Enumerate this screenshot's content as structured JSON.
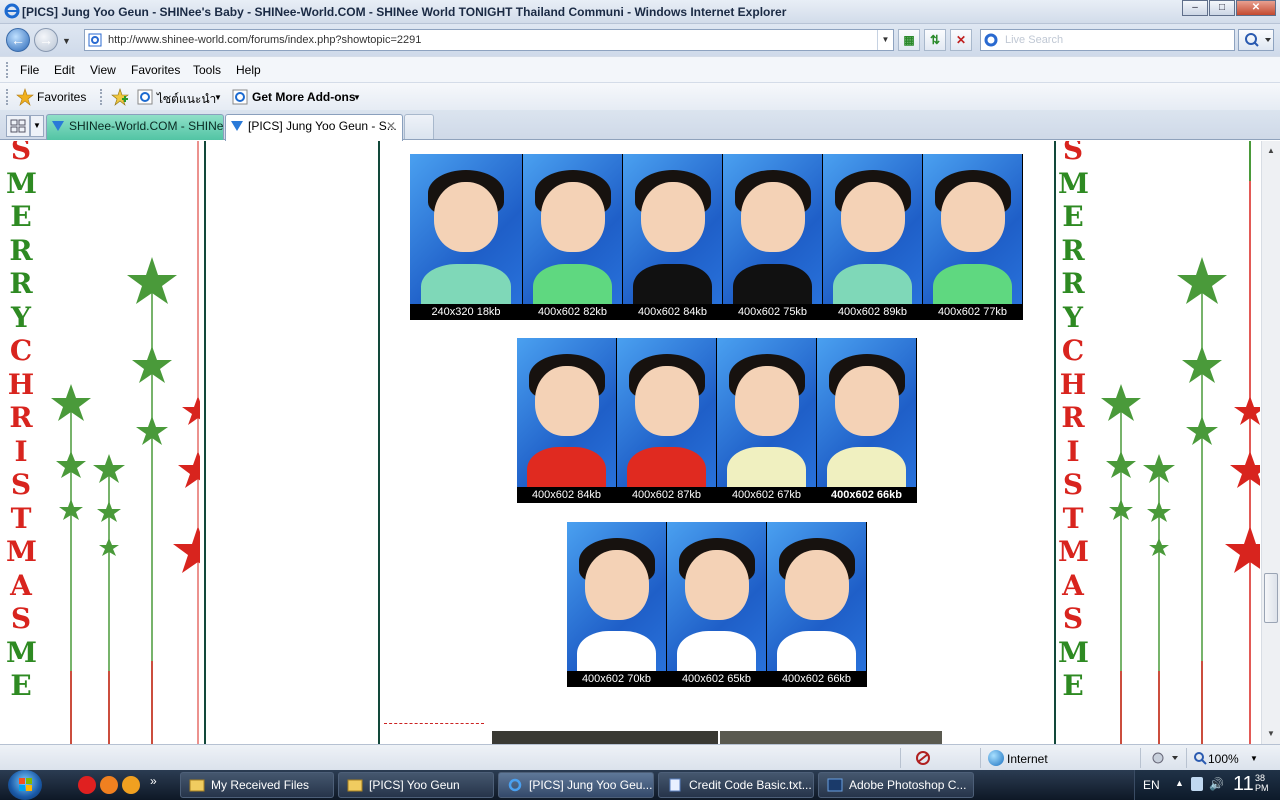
{
  "window": {
    "title": "[PICS] Jung Yoo Geun - SHINee's Baby - SHINee-World.COM - SHINee World TONIGHT Thailand Communi - Windows Internet Explorer",
    "minimize": "–",
    "maximize": "□",
    "close": "✕"
  },
  "address": {
    "url": "http://www.shinee-world.com/forums/index.php?showtopic=2291",
    "search_placeholder": "Live Search"
  },
  "menu": [
    "File",
    "Edit",
    "View",
    "Favorites",
    "Tools",
    "Help"
  ],
  "favorites": {
    "label": "Favorites",
    "suggested": "ไซต์แนะนำ",
    "addons": "Get More Add-ons"
  },
  "tabs": [
    {
      "label": "SHINee-World.COM - SHINe..."
    },
    {
      "label": "[PICS] Jung Yoo Geun - S..."
    }
  ],
  "sidebar_text": [
    "S",
    "M",
    "E",
    "R",
    "R",
    "Y",
    "C",
    "H",
    "R",
    "I",
    "S",
    "T",
    "M",
    "A",
    "S",
    "M",
    "E"
  ],
  "gallery": {
    "row1": [
      "240x320 18kb",
      "400x602 82kb",
      "400x602 84kb",
      "400x602 75kb",
      "400x602 89kb",
      "400x602 77kb"
    ],
    "row2": [
      "400x602 84kb",
      "400x602 87kb",
      "400x602 67kb",
      "400x602 66kb"
    ],
    "row3": [
      "400x602 70kb",
      "400x602 65kb",
      "400x602 66kb"
    ]
  },
  "status": {
    "zone": "Internet",
    "zoom": "100%"
  },
  "taskbar": {
    "tasks": [
      "My Received Files",
      "[PICS] Yoo Geun",
      "[PICS] Jung Yoo Geu...",
      "Credit Code Basic.txt...",
      "Adobe Photoshop C..."
    ],
    "lang": "EN",
    "clock_big": "11",
    "clock_small_1": "38",
    "clock_small_2": "PM"
  },
  "colors": {
    "green_letter": "#2e8a22",
    "red_letter": "#d8241e",
    "frame": "#12483a"
  }
}
